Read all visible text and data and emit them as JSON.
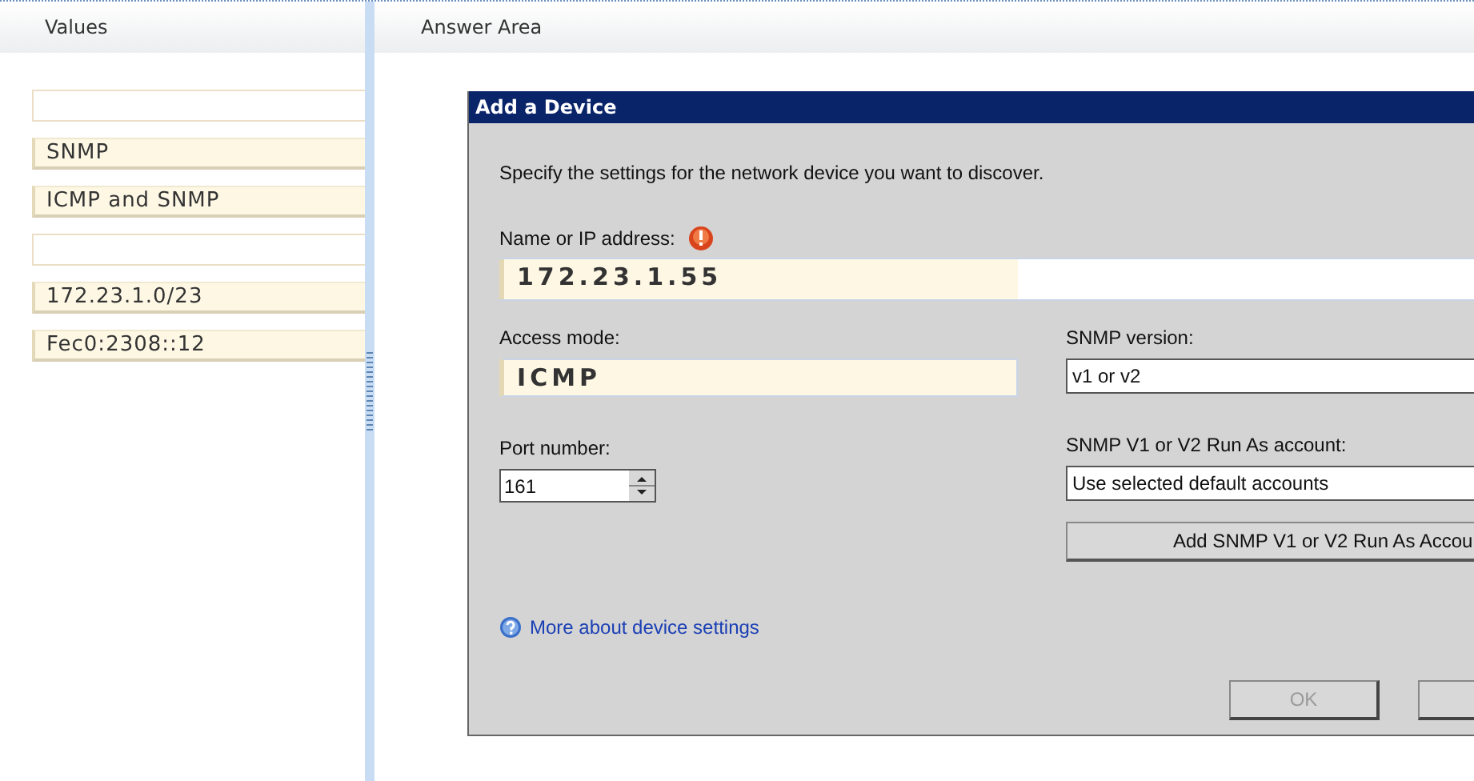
{
  "header": {
    "values_title": "Values",
    "answer_title": "Answer Area"
  },
  "values": [
    {
      "kind": "empty"
    },
    {
      "kind": "value",
      "text": "SNMP"
    },
    {
      "kind": "value",
      "text": "ICMP and SNMP"
    },
    {
      "kind": "empty"
    },
    {
      "kind": "value",
      "text": "172.23.1.0/23"
    },
    {
      "kind": "value",
      "text": "Fec0:2308::12"
    }
  ],
  "dialog": {
    "title": "Add a Device",
    "intro": "Specify the settings for the network device you want to discover.",
    "name_label": "Name or IP address:",
    "name_answer": "172.23.1.55",
    "access_label": "Access mode:",
    "access_answer": "ICMP",
    "snmp_version_label": "SNMP version:",
    "snmp_version_value": "v1 or v2",
    "port_label": "Port number:",
    "port_value": "161",
    "run_as_label": "SNMP V1 or V2 Run As account:",
    "run_as_value": "Use selected default accounts",
    "add_button": "Add SNMP V1 or V2 Run As Accou",
    "help_link": "More about device settings",
    "buttons": [
      {
        "kind": "labelled",
        "label": "OK",
        "disabled": true
      },
      {
        "kind": "blank"
      }
    ]
  }
}
